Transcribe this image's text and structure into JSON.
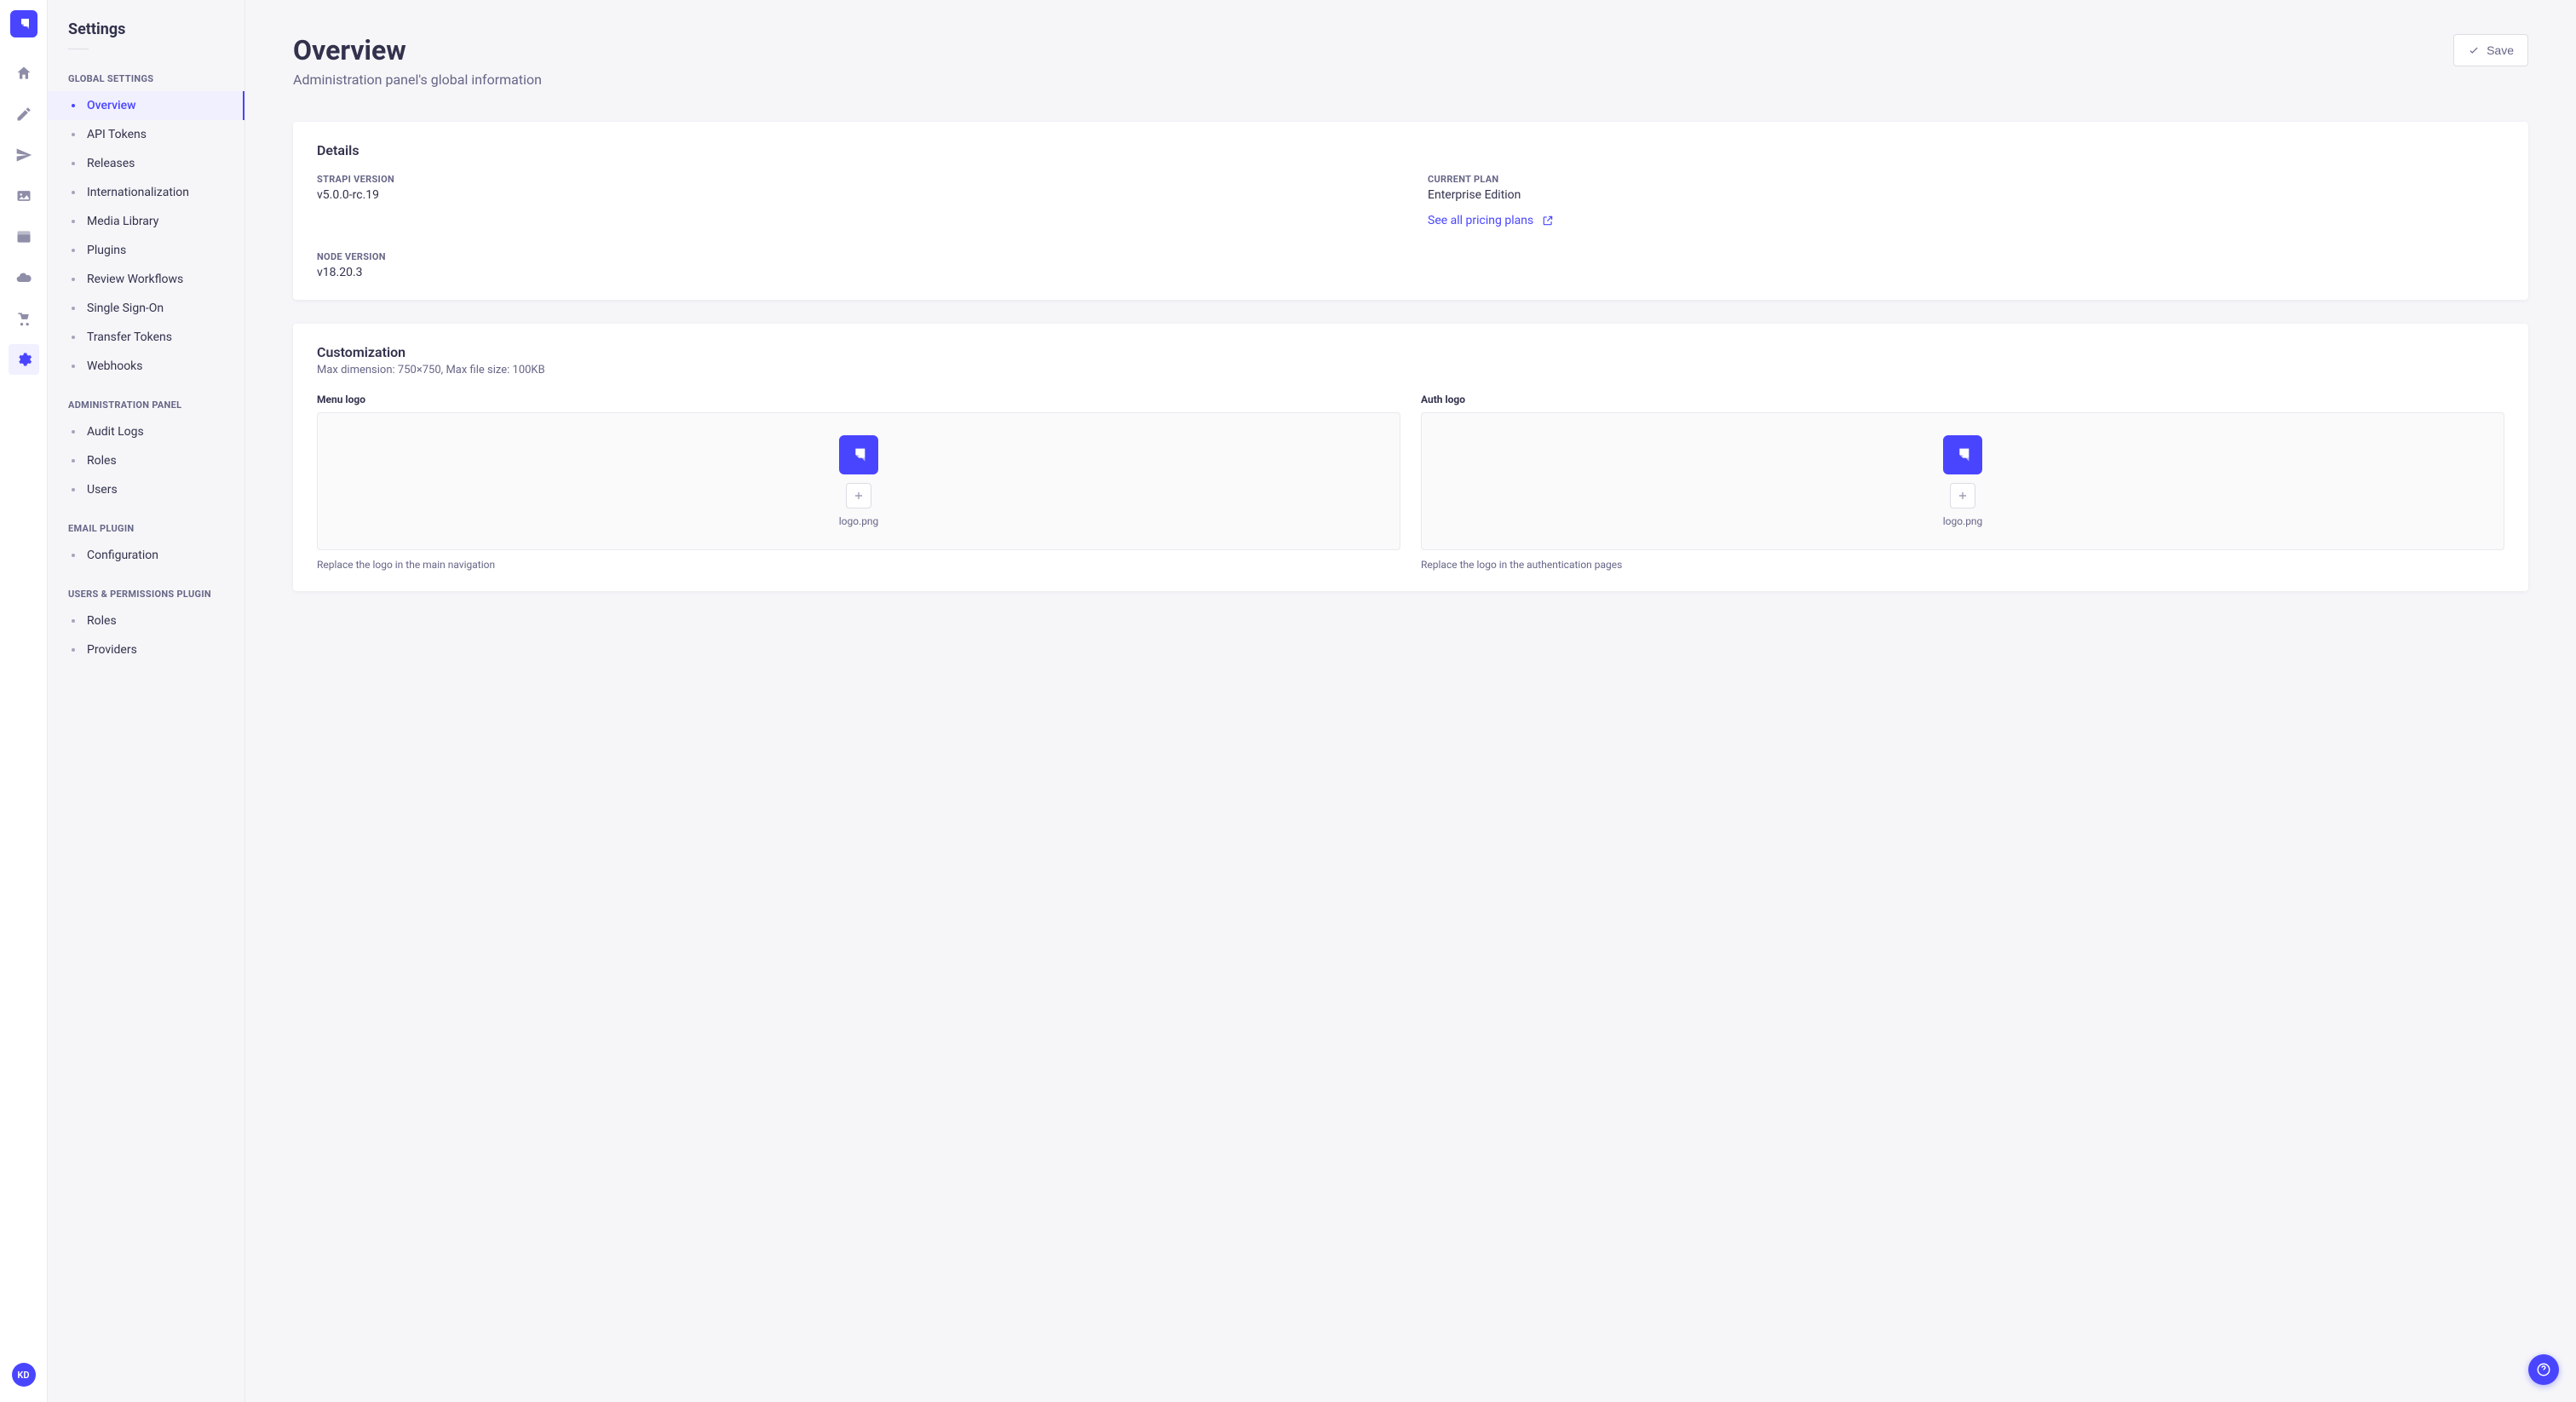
{
  "rail": {
    "avatar_initials": "KD"
  },
  "sidebar": {
    "title": "Settings",
    "groups": [
      {
        "label": "GLOBAL SETTINGS",
        "items": [
          {
            "label": "Overview",
            "active": true
          },
          {
            "label": "API Tokens"
          },
          {
            "label": "Releases"
          },
          {
            "label": "Internationalization"
          },
          {
            "label": "Media Library"
          },
          {
            "label": "Plugins"
          },
          {
            "label": "Review Workflows"
          },
          {
            "label": "Single Sign-On"
          },
          {
            "label": "Transfer Tokens"
          },
          {
            "label": "Webhooks"
          }
        ]
      },
      {
        "label": "ADMINISTRATION PANEL",
        "items": [
          {
            "label": "Audit Logs"
          },
          {
            "label": "Roles"
          },
          {
            "label": "Users"
          }
        ]
      },
      {
        "label": "EMAIL PLUGIN",
        "items": [
          {
            "label": "Configuration"
          }
        ]
      },
      {
        "label": "USERS & PERMISSIONS PLUGIN",
        "items": [
          {
            "label": "Roles"
          },
          {
            "label": "Providers"
          }
        ]
      }
    ]
  },
  "page": {
    "title": "Overview",
    "subtitle": "Administration panel's global information",
    "save_label": "Save"
  },
  "details": {
    "heading": "Details",
    "strapi_label": "STRAPI VERSION",
    "strapi_value": "v5.0.0-rc.19",
    "plan_label": "CURRENT PLAN",
    "plan_value": "Enterprise Edition",
    "pricing_link": "See all pricing plans",
    "node_label": "NODE VERSION",
    "node_value": "v18.20.3"
  },
  "customization": {
    "heading": "Customization",
    "sub": "Max dimension: 750×750, Max file size: 100KB",
    "menu_logo_label": "Menu logo",
    "menu_logo_filename": "logo.png",
    "menu_logo_hint": "Replace the logo in the main navigation",
    "auth_logo_label": "Auth logo",
    "auth_logo_filename": "logo.png",
    "auth_logo_hint": "Replace the logo in the authentication pages"
  }
}
